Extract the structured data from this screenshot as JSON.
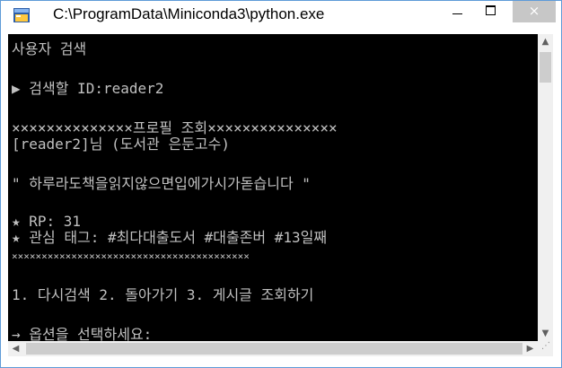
{
  "window": {
    "title": "C:\\ProgramData\\Miniconda3\\python.exe",
    "icon": "console-app-icon",
    "buttons": {
      "minimize": "minimize",
      "maximize": "maximize",
      "close": "×"
    }
  },
  "console": {
    "foreground": "#c0c0c0",
    "background": "#000000",
    "lines": [
      "사용자 검색",
      "▶ 검색할 ID:reader2",
      "××××××××××××××프로필 조회×××××××××××××××",
      "[reader2]님 (도서관 은둔고수)",
      "\" 하루라도책을읽지않으면입에가시가돋습니다 \"",
      "★ RP: 31",
      "★ 관심 태그: #최다대출도서 #대출존버 #13일째",
      "××××××××××××××××××××××××××××××××××××××××",
      "1. 다시검색 2. 돌아가기 3. 게시글 조회하기",
      "→ 옵션을 선택하세요:"
    ]
  },
  "scrollbars": {
    "up_arrow": "▲",
    "down_arrow": "▼",
    "left_arrow": "◀",
    "right_arrow": "▶"
  }
}
